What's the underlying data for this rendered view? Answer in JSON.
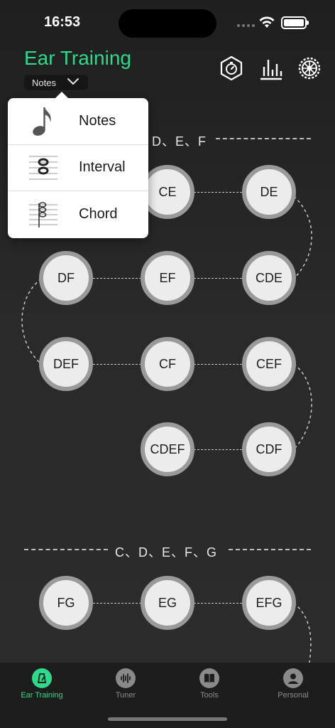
{
  "status": {
    "time": "16:53"
  },
  "header": {
    "title": "Ear Training",
    "mode_selected": "Notes",
    "accent_color": "#2fd98c"
  },
  "dropdown_menu": {
    "items": [
      {
        "label": "Notes",
        "icon": "eighth-note-icon"
      },
      {
        "label": "Interval",
        "icon": "interval-staff-icon"
      },
      {
        "label": "Chord",
        "icon": "chord-staff-icon"
      }
    ]
  },
  "sections": [
    {
      "label": "D、E、F",
      "nodes": [
        "CE",
        "DE",
        "DF",
        "EF",
        "CDE",
        "DEF",
        "CF",
        "CEF",
        "CDEF",
        "CDF"
      ]
    },
    {
      "label": "C、D、E、F、G",
      "nodes": [
        "FG",
        "EG",
        "EFG"
      ]
    }
  ],
  "tab_bar": {
    "tabs": [
      {
        "label": "Ear Training",
        "icon": "ear-training-icon",
        "active": true
      },
      {
        "label": "Tuner",
        "icon": "tuner-waveform-icon",
        "active": false
      },
      {
        "label": "Tools",
        "icon": "book-icon",
        "active": false
      },
      {
        "label": "Personal",
        "icon": "person-icon",
        "active": false
      }
    ]
  }
}
